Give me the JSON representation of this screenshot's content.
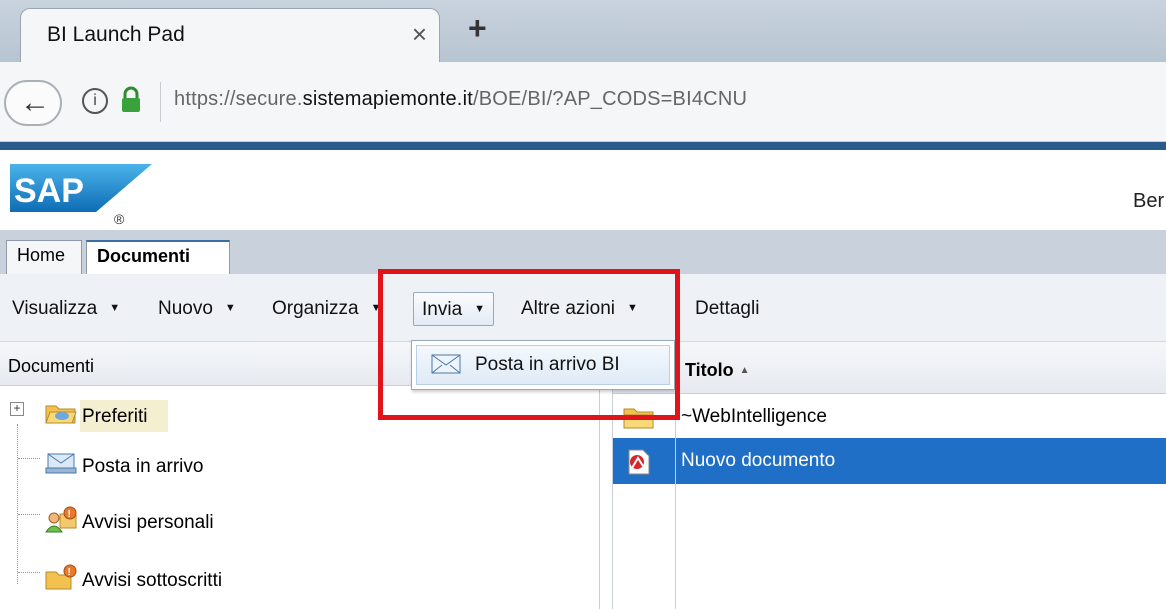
{
  "browser": {
    "tab_title": "BI Launch Pad",
    "tab_close_icon": "×",
    "new_tab_icon": "+",
    "back_icon": "←",
    "info_icon": "i",
    "url_prefix": "https://secure.",
    "url_domain": "sistemapiemonte.it",
    "url_path": "/BOE/BI/?AP_CODS=BI4CNU"
  },
  "header": {
    "logo_text": "SAP",
    "logo_reg": "®",
    "user_name_partial": "Ber"
  },
  "app_tabs": [
    {
      "label": "Home"
    },
    {
      "label": "Documenti"
    }
  ],
  "toolbar": {
    "items": [
      {
        "label": "Visualizza"
      },
      {
        "label": "Nuovo"
      },
      {
        "label": "Organizza"
      },
      {
        "label": "Invia"
      },
      {
        "label": "Altre azioni"
      },
      {
        "label": "Dettagli"
      }
    ]
  },
  "dropdown": {
    "items": [
      {
        "label": "Posta in arrivo BI",
        "icon": "envelope-icon"
      }
    ]
  },
  "left_panel": {
    "header": "Documenti",
    "tree": [
      {
        "label": "Preferiti",
        "icon": "folder-favorites-icon",
        "expander": "+"
      },
      {
        "label": "Posta in arrivo",
        "icon": "inbox-icon"
      },
      {
        "label": "Avvisi personali",
        "icon": "personal-alerts-icon"
      },
      {
        "label": "Avvisi sottoscritti",
        "icon": "subscribed-alerts-icon"
      }
    ]
  },
  "right_panel": {
    "column_title": "Titolo",
    "sort_indicator": "▲",
    "rows": [
      {
        "name": "~WebIntelligence",
        "icon": "folder-icon",
        "selected": false
      },
      {
        "name": "Nuovo documento",
        "icon": "webi-document-icon",
        "selected": true
      }
    ]
  },
  "colors": {
    "selection": "#1f6fc6",
    "highlight_box": "#e0141b",
    "sap_blue": "#1b7fc4"
  }
}
